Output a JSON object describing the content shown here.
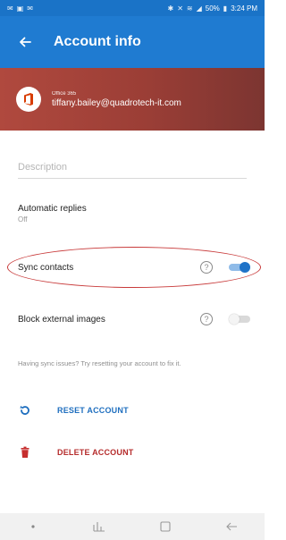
{
  "status_bar": {
    "battery": "50%",
    "time": "3:24 PM"
  },
  "app_bar": {
    "title": "Account info",
    "back_icon": "arrow-left-icon"
  },
  "account": {
    "type": "Office 365",
    "email": "tiffany.bailey@quadrotech-it.com",
    "logo_icon": "office-logo-icon"
  },
  "description": {
    "placeholder": "Description",
    "value": ""
  },
  "automatic_replies": {
    "title": "Automatic replies",
    "status": "Off"
  },
  "sync_contacts": {
    "label": "Sync contacts",
    "help_icon": "?",
    "enabled": true
  },
  "block_images": {
    "label": "Block external images",
    "help_icon": "?",
    "enabled": false
  },
  "hint": "Having sync issues? Try resetting your account to fix it.",
  "actions": {
    "reset_label": "RESET ACCOUNT",
    "delete_label": "DELETE ACCOUNT"
  },
  "colors": {
    "app_bar": "#1f7bd1",
    "banner": "#a5433a",
    "accent": "#1f73c8",
    "danger": "#b52b2b",
    "highlight": "#c83a3a"
  }
}
